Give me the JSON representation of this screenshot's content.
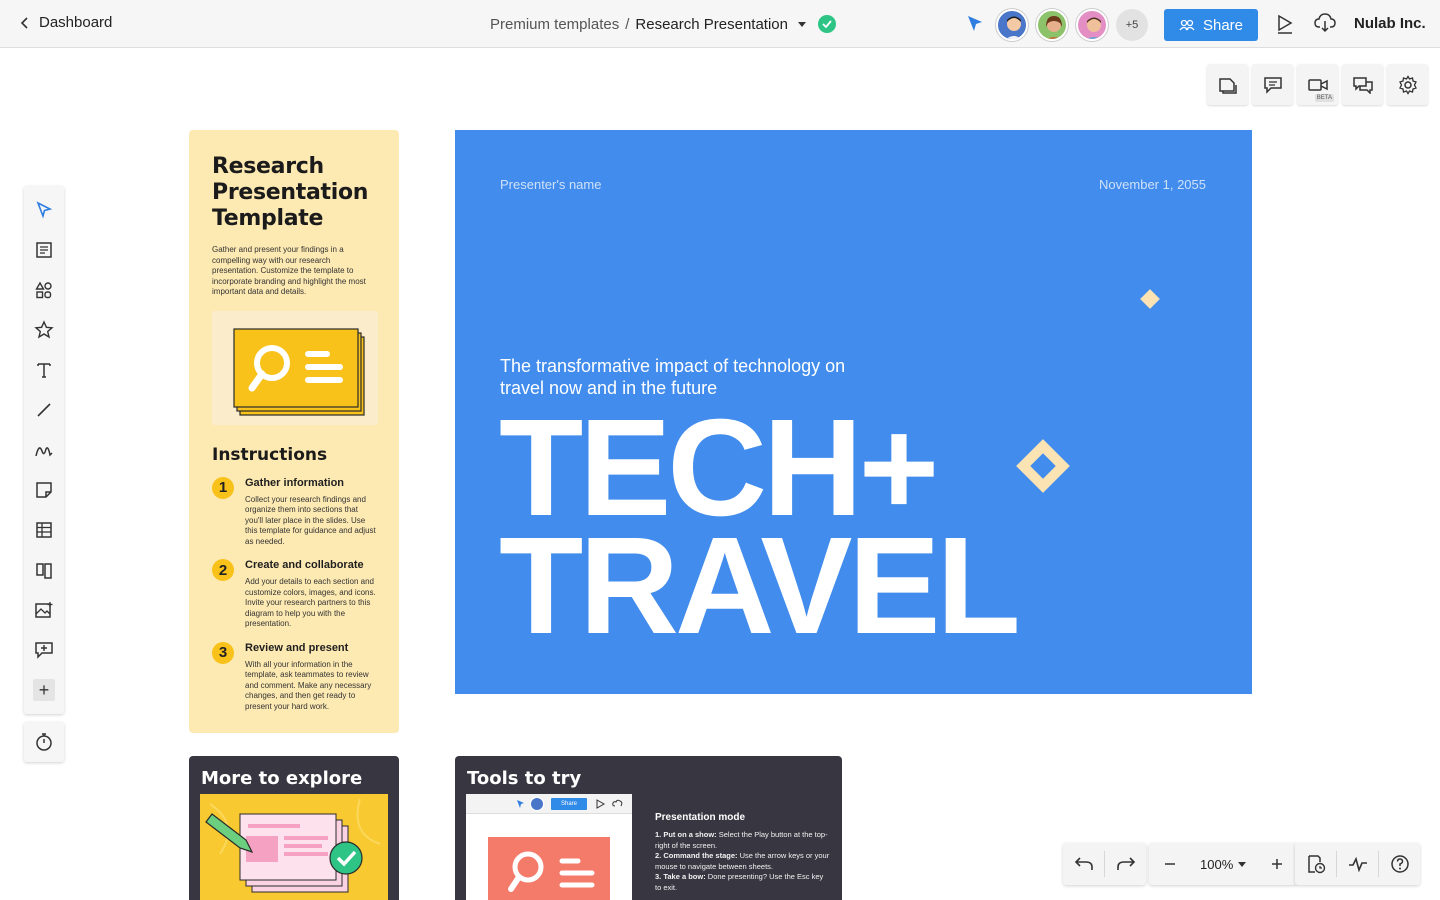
{
  "topbar": {
    "back_label": "Dashboard",
    "breadcrumb_parent": "Premium templates",
    "breadcrumb_separator": "/",
    "document_title": "Research Presentation",
    "extra_collaborators": "+5",
    "share_label": "Share",
    "org_name": "Nulab Inc."
  },
  "right_tools": {
    "beta_badge": "BETA"
  },
  "info_panel": {
    "title": "Research Presentation Template",
    "description": "Gather and present your findings in a compelling way with our research presentation. Customize the template to incorporate branding and highlight the most important data and details.",
    "instructions_heading": "Instructions",
    "steps": [
      {
        "num": "1",
        "title": "Gather information",
        "text": "Collect your research findings and organize them into sections that you'll later place in the slides. Use this template for guidance and adjust as needed."
      },
      {
        "num": "2",
        "title": "Create and collaborate",
        "text": "Add your details to each section and customize colors, images, and icons. Invite your research partners to this diagram to help you with the presentation."
      },
      {
        "num": "3",
        "title": "Review and present",
        "text": "With all your information in the template, ask teammates to review and comment. Make any necessary changes, and then get ready to present your hard work."
      }
    ]
  },
  "slide": {
    "presenter": "Presenter's name",
    "date": "November 1, 2055",
    "subtitle": "The transformative impact of technology on travel now and in the future",
    "headline_1": "TECH+",
    "headline_2": "TRAVEL",
    "accent_color": "#fbe3b4",
    "background_color": "#418cec"
  },
  "explore_card": {
    "title": "More to explore"
  },
  "tools_card": {
    "title": "Tools to try",
    "mini_share": "Share",
    "heading": "Presentation mode",
    "items": [
      {
        "label": "1. Put on a show:",
        "text": " Select the Play button at the top-right of the screen."
      },
      {
        "label": "2. Command the stage:",
        "text": " Use the arrow keys or your mouse to navigate between sheets."
      },
      {
        "label": "3. Take a bow:",
        "text": " Done presenting? Use the Esc key to exit."
      }
    ]
  },
  "controls": {
    "zoom": "100%"
  }
}
